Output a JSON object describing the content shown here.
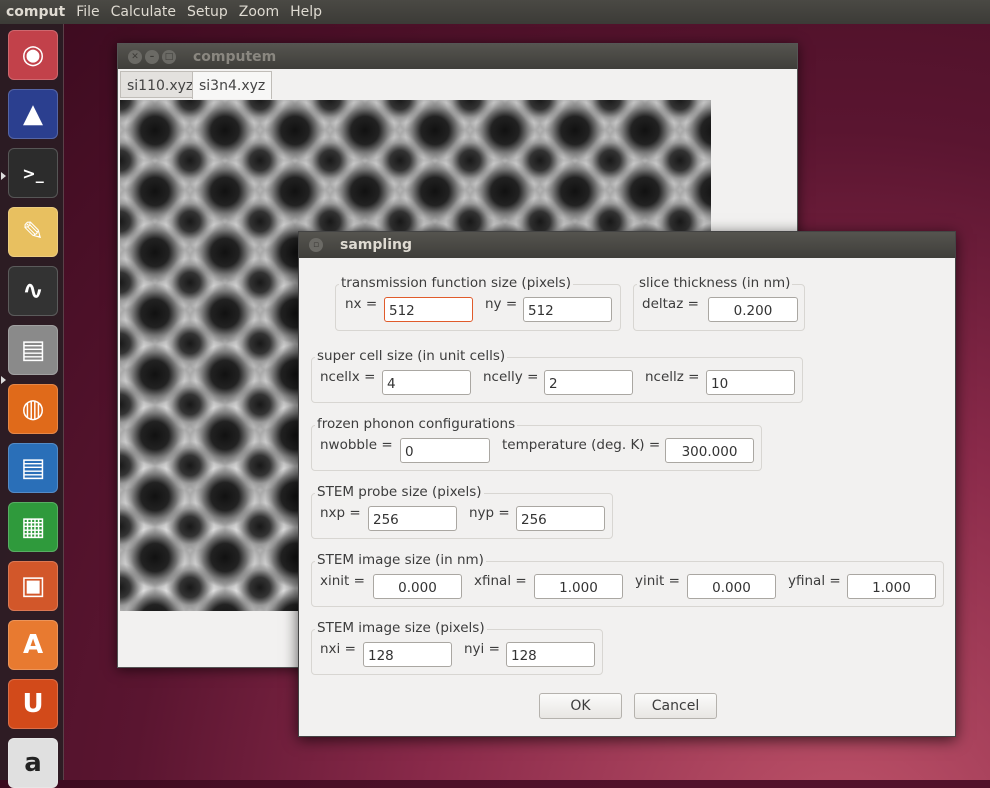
{
  "topbar": {
    "app_name": "comput",
    "menu": [
      "File",
      "Calculate",
      "Setup",
      "Zoom",
      "Help"
    ]
  },
  "launcher": {
    "icons": [
      "ubuntu-dash-icon",
      "computem-app-icon",
      "terminal-icon",
      "libreoffice-draw-icon",
      "system-monitor-icon",
      "file-manager-icon",
      "firefox-icon",
      "libreoffice-writer-icon",
      "libreoffice-calc-icon",
      "libreoffice-impress-icon",
      "software-center-icon",
      "ubuntu-one-icon",
      "amazon-icon"
    ]
  },
  "main_window": {
    "title": "computem",
    "tabs": [
      "si110.xyz",
      "si3n4.xyz"
    ],
    "active_tab": 1
  },
  "dialog": {
    "title": "sampling",
    "groups": [
      {
        "legend": "transmission function size (pixels)",
        "fields": [
          {
            "label": "nx =",
            "value": "512"
          },
          {
            "label": "ny =",
            "value": "512"
          }
        ]
      },
      {
        "legend": "slice thickness (in nm)",
        "fields": [
          {
            "label": "deltaz =",
            "value": "0.200"
          }
        ]
      },
      {
        "legend": "super cell size (in unit cells)",
        "fields": [
          {
            "label": "ncellx =",
            "value": "4"
          },
          {
            "label": "ncelly =",
            "value": "2"
          },
          {
            "label": "ncellz =",
            "value": "10"
          }
        ]
      },
      {
        "legend": "frozen phonon configurations",
        "fields": [
          {
            "label": "nwobble =",
            "value": "0"
          },
          {
            "label": "temperature (deg. K) =",
            "value": "300.000"
          }
        ]
      },
      {
        "legend": "STEM probe size (pixels)",
        "fields": [
          {
            "label": "nxp =",
            "value": "256"
          },
          {
            "label": "nyp =",
            "value": "256"
          }
        ]
      },
      {
        "legend": "STEM image size (in nm)",
        "fields": [
          {
            "label": "xinit =",
            "value": "0.000"
          },
          {
            "label": "xfinal =",
            "value": "1.000"
          },
          {
            "label": "yinit =",
            "value": "0.000"
          },
          {
            "label": "yfinal =",
            "value": "1.000"
          }
        ]
      },
      {
        "legend": "STEM image size (pixels)",
        "fields": [
          {
            "label": "nxi =",
            "value": "128"
          },
          {
            "label": "nyi =",
            "value": "128"
          }
        ]
      }
    ],
    "ok_label": "OK",
    "cancel_label": "Cancel"
  },
  "colors": {
    "focus_border": "#e05b2b",
    "titlebar": "#3f3e3a"
  }
}
